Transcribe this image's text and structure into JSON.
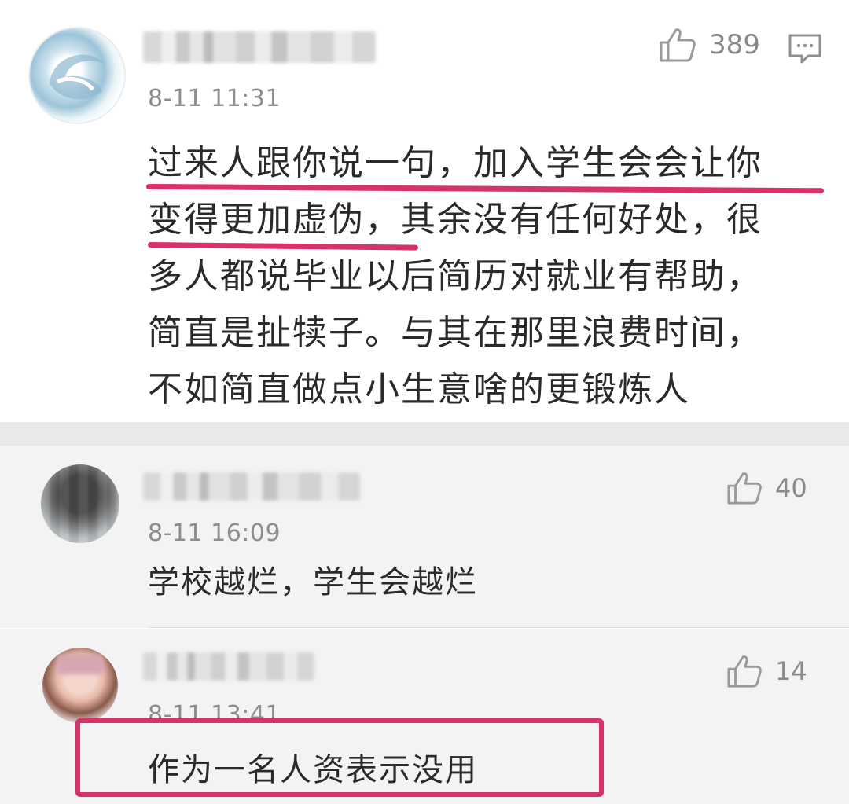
{
  "colors": {
    "annotation": "#d7336a",
    "timestamp": "#8d8d8d",
    "count": "#8a8a8a"
  },
  "comments": [
    {
      "time": "8-11 11:31",
      "likes": "389",
      "lines": [
        "过来人跟你说一句，加入学生会会让你",
        "变得更加虚伪，其余没有任何好处，很",
        "多人都说毕业以后简历对就业有帮助，",
        "简直是扯犊子。与其在那里浪费时间，",
        "不如简直做点小生意啥的更锻炼人"
      ],
      "icons": [
        "thumbs-up-icon",
        "reply-icon"
      ]
    },
    {
      "time": "8-11 16:09",
      "likes": "40",
      "lines": [
        "学校越烂，学生会越烂"
      ],
      "icons": [
        "thumbs-up-icon"
      ]
    },
    {
      "time": "8-11 13:41",
      "likes": "14",
      "lines": [
        "作为一名人资表示没用"
      ],
      "icons": [
        "thumbs-up-icon"
      ]
    }
  ]
}
